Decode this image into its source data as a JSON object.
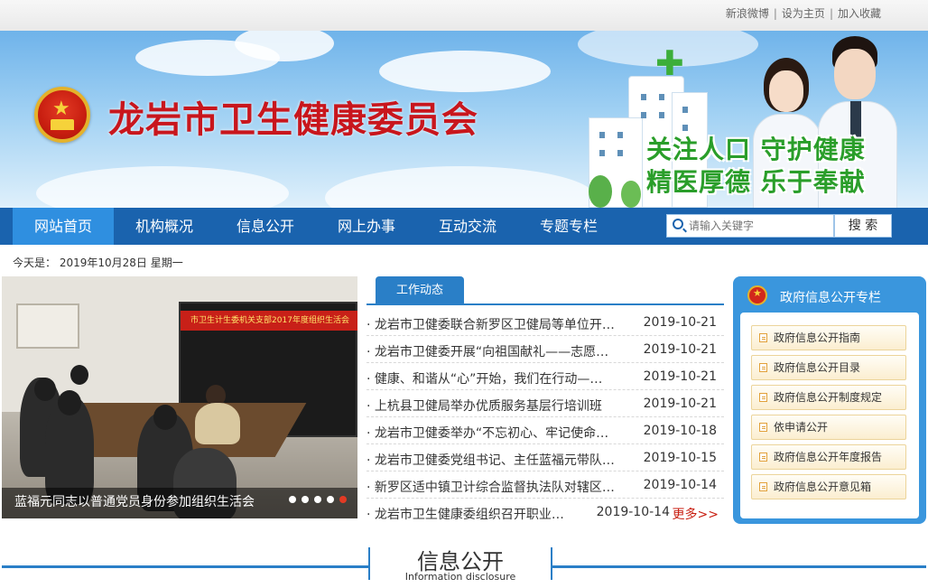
{
  "top_links": {
    "weibo": "新浪微博",
    "homepage": "设为主页",
    "favorite": "加入收藏",
    "separator": "|"
  },
  "banner": {
    "site_title": "龙岩市卫生健康委员会",
    "slogan_line1": "关注人口  守护健康",
    "slogan_line2": "精医厚德  乐于奉献",
    "colors": {
      "title": "#c8161d",
      "slogan": "#2a9e2a"
    }
  },
  "nav": {
    "items": [
      {
        "label": "网站首页",
        "active": true
      },
      {
        "label": "机构概况",
        "active": false
      },
      {
        "label": "信息公开",
        "active": false
      },
      {
        "label": "网上办事",
        "active": false
      },
      {
        "label": "互动交流",
        "active": false
      },
      {
        "label": "专题专栏",
        "active": false
      }
    ],
    "search_placeholder": "请输入关键字",
    "search_button": "搜  索",
    "colors": {
      "bar": "#1a63ae",
      "active": "#2f8fe0"
    }
  },
  "date_line": "今天是： 2019年10月28日 星期一",
  "slideshow": {
    "caption": "蓝福元同志以普通党员身份参加组织生活会",
    "screen_text": "市卫生计生委机关支部2017年度组织生活会",
    "dots": 5,
    "active_dot": 5
  },
  "news": {
    "tab": "工作动态",
    "more": "更多>>",
    "items": [
      {
        "title": "· 龙岩市卫健委联合新罗区卫健局等单位开…",
        "date": "2019-10-21"
      },
      {
        "title": "· 龙岩市卫健委开展“向祖国献礼——志愿…",
        "date": "2019-10-21"
      },
      {
        "title": "· 健康、和谐从“心”开始，我们在行动—…",
        "date": "2019-10-21"
      },
      {
        "title": "· 上杭县卫健局举办优质服务基层行培训班",
        "date": "2019-10-21"
      },
      {
        "title": "· 龙岩市卫健委举办“不忘初心、牢记使命…",
        "date": "2019-10-18"
      },
      {
        "title": "· 龙岩市卫健委党组书记、主任蓝福元带队…",
        "date": "2019-10-15"
      },
      {
        "title": "· 新罗区适中镇卫计综合监督执法队对辖区…",
        "date": "2019-10-14"
      },
      {
        "title": "· 龙岩市卫生健康委组织召开职业…",
        "date": "2019-10-14"
      }
    ]
  },
  "gov_panel": {
    "title": "政府信息公开专栏",
    "items": [
      "政府信息公开指南",
      "政府信息公开目录",
      "政府信息公开制度规定",
      "依申请公开",
      "政府信息公开年度报告",
      "政府信息公开意见箱"
    ],
    "colors": {
      "panel": "#3a96dd"
    }
  },
  "section": {
    "title": "信息公开",
    "subtitle": "Information disclosure"
  }
}
